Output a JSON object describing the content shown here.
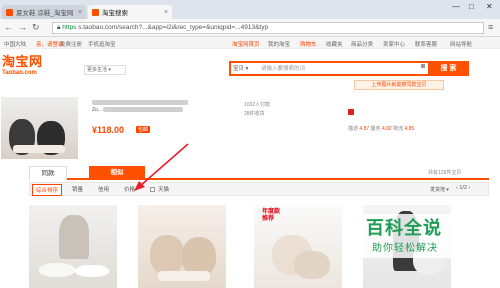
{
  "browser": {
    "tabs": [
      {
        "title": "夏女鞋 凉鞋_淘宝网"
      },
      {
        "title": "淘宝搜索"
      }
    ],
    "url_prefix": "https",
    "url_text": "s.taobao.com/search?...&app=i2i&rec_type=&uniqpid=...4913&typ",
    "win_controls": [
      "—",
      "□",
      "✕"
    ]
  },
  "site_nav": {
    "left": [
      "中国大陆",
      "亲，请登录",
      "免费注册",
      "手机逛淘宝"
    ],
    "right": [
      "淘宝网首页",
      "我的淘宝",
      "购物车",
      "收藏夹",
      "商品分类",
      "卖家中心",
      "联系客服",
      "网站导航"
    ]
  },
  "header": {
    "logo_cn": "淘宝网",
    "logo_en": "Taobao.com",
    "more_categories": "更多生活",
    "search_scope": "宝贝",
    "search_placeholder": "请输入要搜索的词",
    "search_button": "搜 索",
    "image_search_tip": "上传图片就能搜同款宝贝"
  },
  "product": {
    "title_line2": "Zo...",
    "price": "¥118.00",
    "badge": "包邮",
    "sales": "1032人付款",
    "location": "28件收货",
    "ratings": {
      "label1": "描述",
      "v1": "4.87",
      "label2": "服务",
      "v2": "4.82",
      "label3": "物流",
      "v3": "4.85"
    }
  },
  "result_tabs": {
    "same": "同款",
    "similar": "相似",
    "count_note": "共有129件宝贝"
  },
  "sort_bar": {
    "options": [
      "综合排序",
      "销量",
      "信用",
      "价格"
    ],
    "tmall": "天猫",
    "ship_to": "发货地",
    "pager": "‹  1/2  ›"
  },
  "cards": [
    {
      "promo": ""
    },
    {
      "promo": ""
    },
    {
      "promo": "年度款\n推荐"
    },
    {
      "promo": ""
    }
  ],
  "watermark": {
    "big": "百科全说",
    "small": "助你轻松解决"
  },
  "colors": {
    "brand": "#ff5000",
    "arrow": "#e8202a",
    "watermark": "#1f9d55"
  }
}
